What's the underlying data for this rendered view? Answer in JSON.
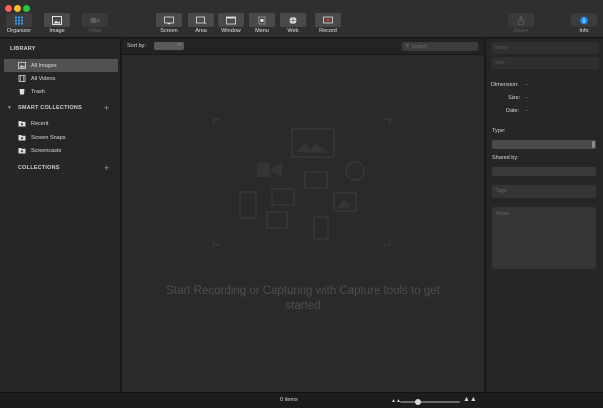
{
  "toolbar": {
    "buttons": [
      {
        "id": "organizer",
        "label": "Organizer",
        "icon": "grid-icon",
        "active": true
      },
      {
        "id": "image",
        "label": "Image",
        "icon": "image-icon",
        "active": true
      },
      {
        "id": "video",
        "label": "Video",
        "icon": "video-icon",
        "active": false
      },
      {
        "id": "screen",
        "label": "Screen",
        "icon": "screen-capture-icon",
        "active": true
      },
      {
        "id": "area",
        "label": "Area",
        "icon": "area-capture-icon",
        "active": true
      },
      {
        "id": "window",
        "label": "Window",
        "icon": "window-capture-icon",
        "active": true
      },
      {
        "id": "menu",
        "label": "Menu",
        "icon": "menu-capture-icon",
        "active": true
      },
      {
        "id": "web",
        "label": "Web",
        "icon": "web-capture-icon",
        "active": true
      },
      {
        "id": "record",
        "label": "Record",
        "icon": "record-icon",
        "active": true
      },
      {
        "id": "share",
        "label": "Share",
        "icon": "share-icon",
        "active": false
      },
      {
        "id": "info",
        "label": "Info",
        "icon": "info-icon",
        "active": true
      }
    ]
  },
  "sidebar": {
    "library_header": "LIBRARY",
    "library_items": [
      {
        "label": "All Images",
        "icon": "images-icon",
        "selected": true
      },
      {
        "label": "All Videos",
        "icon": "film-icon",
        "selected": false
      },
      {
        "label": "Trash",
        "icon": "trash-icon",
        "selected": false
      }
    ],
    "smart_header": "SMART COLLECTIONS",
    "smart_items": [
      {
        "label": "Recent",
        "icon": "smart-folder-icon"
      },
      {
        "label": "Screen Snaps",
        "icon": "smart-folder-icon"
      },
      {
        "label": "Screencasts",
        "icon": "smart-folder-icon"
      }
    ],
    "collections_header": "COLLECTIONS",
    "add_symbol": "+"
  },
  "main": {
    "sort_label": "Sort by:",
    "search_placeholder": "Search",
    "empty_message": "Start Recording or Capturing with Capture tools to get started"
  },
  "inspector": {
    "name_placeholder": "Name",
    "size_placeholder": "Size",
    "dimension_label": "Dimension:",
    "dimension_value": "--",
    "size_label": "Size:",
    "size_value": "--",
    "date_label": "Date:",
    "date_value": "--",
    "type_label": "Type:",
    "shared_label": "Shared by:",
    "tags_placeholder": "Tags",
    "notes_placeholder": "Notes"
  },
  "statusbar": {
    "items_count": "0 items",
    "zoom_level": 0.3
  },
  "colors": {
    "accent_info": "#1e90ff",
    "record_red": "#e0303a",
    "organizer_blue": "#3a9bff"
  }
}
